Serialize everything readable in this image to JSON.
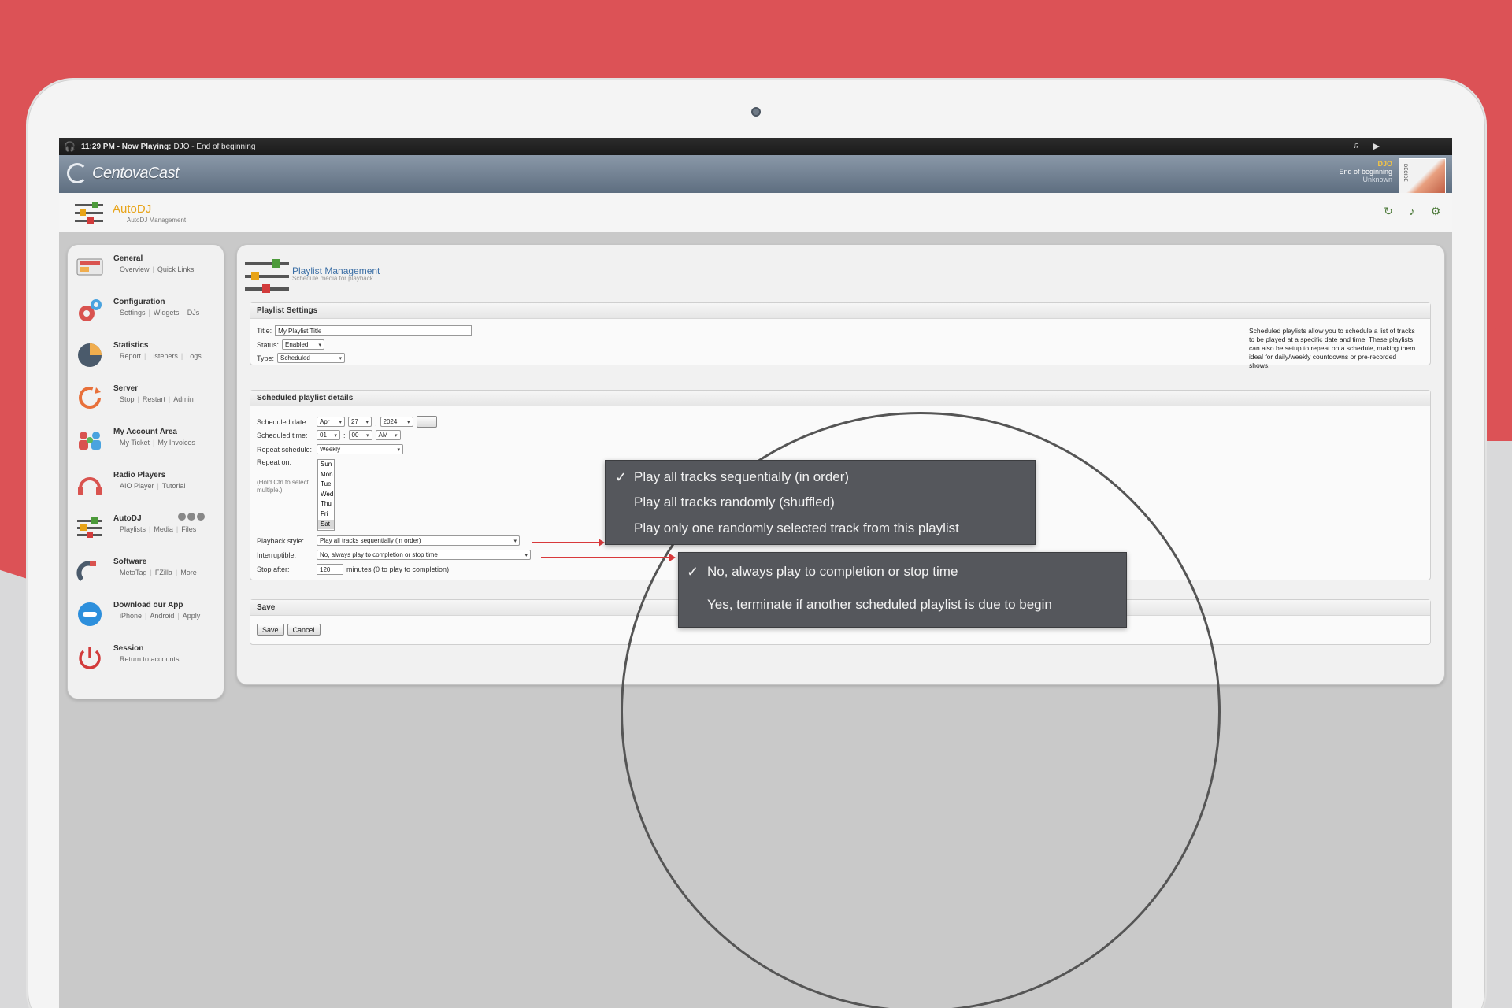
{
  "now_playing": {
    "time_label": "11:29 PM - Now Playing:",
    "track": "DJO - End of beginning"
  },
  "brand": {
    "name": "CentovaCast"
  },
  "current_track": {
    "artist": "DJO",
    "title": "End of beginning",
    "album": "Unknown",
    "cover_text": "DECIDE"
  },
  "module": {
    "title": "AutoDJ",
    "subtitle": "AutoDJ Management"
  },
  "sidebar": {
    "items": [
      {
        "title": "General",
        "links": [
          "Overview",
          "Quick Links"
        ]
      },
      {
        "title": "Configuration",
        "links": [
          "Settings",
          "Widgets",
          "DJs"
        ]
      },
      {
        "title": "Statistics",
        "links": [
          "Report",
          "Listeners",
          "Logs"
        ]
      },
      {
        "title": "Server",
        "links": [
          "Stop",
          "Restart",
          "Admin"
        ]
      },
      {
        "title": "My Account Area",
        "links": [
          "My Ticket",
          "My Invoices"
        ]
      },
      {
        "title": "Radio Players",
        "links": [
          "AIO Player",
          "Tutorial"
        ]
      },
      {
        "title": "AutoDJ",
        "links": [
          "Playlists",
          "Media",
          "Files"
        ]
      },
      {
        "title": "Software",
        "links": [
          "MetaTag",
          "FZilla",
          "More"
        ]
      },
      {
        "title": "Download our App",
        "links": [
          "iPhone",
          "Android",
          "Apply"
        ]
      },
      {
        "title": "Session",
        "links": [
          "Return to accounts"
        ]
      }
    ]
  },
  "page": {
    "title": "Playlist Management",
    "subtitle": "Schedule media for playback"
  },
  "playlist_settings": {
    "legend": "Playlist Settings",
    "title_label": "Title:",
    "title_value": "My Playlist Title",
    "status_label": "Status:",
    "status_value": "Enabled",
    "type_label": "Type:",
    "type_value": "Scheduled",
    "help": "Scheduled playlists allow you to schedule a list of tracks to be played at a specific date and time. These playlists can also be setup to repeat on a schedule, making them ideal for daily/weekly countdowns or pre-recorded shows."
  },
  "schedule": {
    "legend": "Scheduled playlist details",
    "date_label": "Scheduled date:",
    "month": "Apr",
    "day": "27",
    "year": "2024",
    "date_picker": "...",
    "time_label": "Scheduled time:",
    "hour": "01",
    "minute": "00",
    "ampm": "AM",
    "repeat_label": "Repeat schedule:",
    "repeat_value": "Weekly",
    "repeat_on_label": "Repeat on:",
    "repeat_hint": "(Hold Ctrl to select multiple.)",
    "days": [
      "Sun",
      "Mon",
      "Tue",
      "Wed",
      "Thu",
      "Fri",
      "Sat"
    ],
    "playback_label": "Playback style:",
    "playback_value": "Play all tracks sequentially (in order)",
    "interruptible_label": "Interruptible:",
    "interruptible_value": "No, always play to completion or stop time",
    "stop_label": "Stop after:",
    "stop_value": "120",
    "stop_suffix": "minutes (0 to play to completion)"
  },
  "save_section": {
    "legend": "Save",
    "save_label": "Save",
    "cancel_label": "Cancel"
  },
  "playback_popup": {
    "options": [
      "Play all tracks sequentially (in order)",
      "Play all tracks randomly (shuffled)",
      "Play only one randomly selected track from this playlist"
    ],
    "check": "✓"
  },
  "interruptible_popup": {
    "options": [
      "No, always play to completion or stop time",
      "Yes, terminate if another scheduled playlist is due to begin"
    ],
    "check": "✓"
  },
  "colors": {
    "accent_red": "#dc5256",
    "brand_orange": "#e8a317",
    "link_blue": "#3a6ea5",
    "popup_bg": "#55575c"
  }
}
